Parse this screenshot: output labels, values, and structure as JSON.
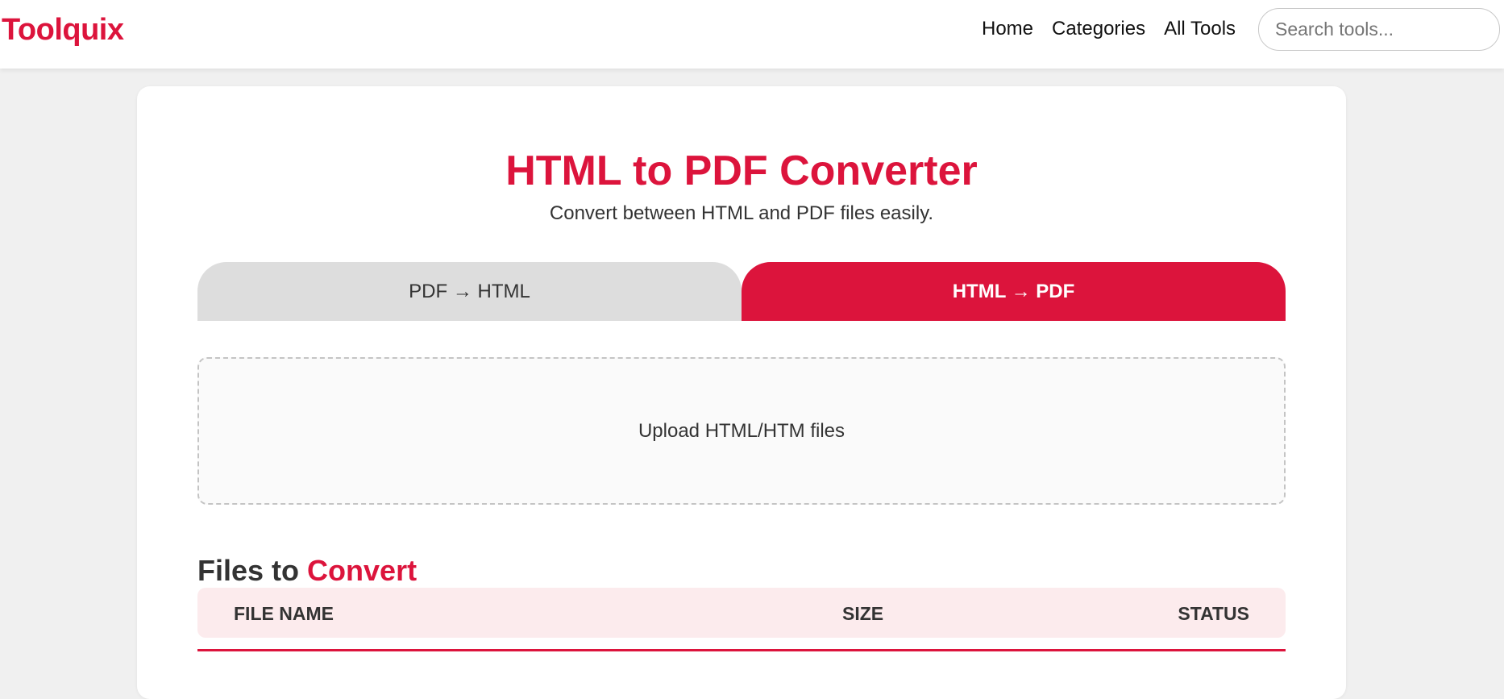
{
  "header": {
    "logo": "Toolquix",
    "nav": [
      "Home",
      "Categories",
      "All Tools"
    ],
    "search_placeholder": "Search tools..."
  },
  "main": {
    "title": "HTML to PDF Converter",
    "subtitle": "Convert between HTML and PDF files easily.",
    "tabs": [
      {
        "label": "PDF → HTML",
        "active": false
      },
      {
        "label": "HTML → PDF",
        "active": true
      }
    ],
    "upload_label": "Upload HTML/HTM files",
    "section_heading_prefix": "Files to",
    "section_heading_accent": "Convert",
    "table": {
      "columns": [
        "File Name",
        "Size",
        "Status"
      ]
    }
  },
  "colors": {
    "accent": "#dc143c",
    "tab_inactive": "#dddddd",
    "table_header_bg": "#fcebed",
    "page_bg": "#f0f0f0"
  }
}
